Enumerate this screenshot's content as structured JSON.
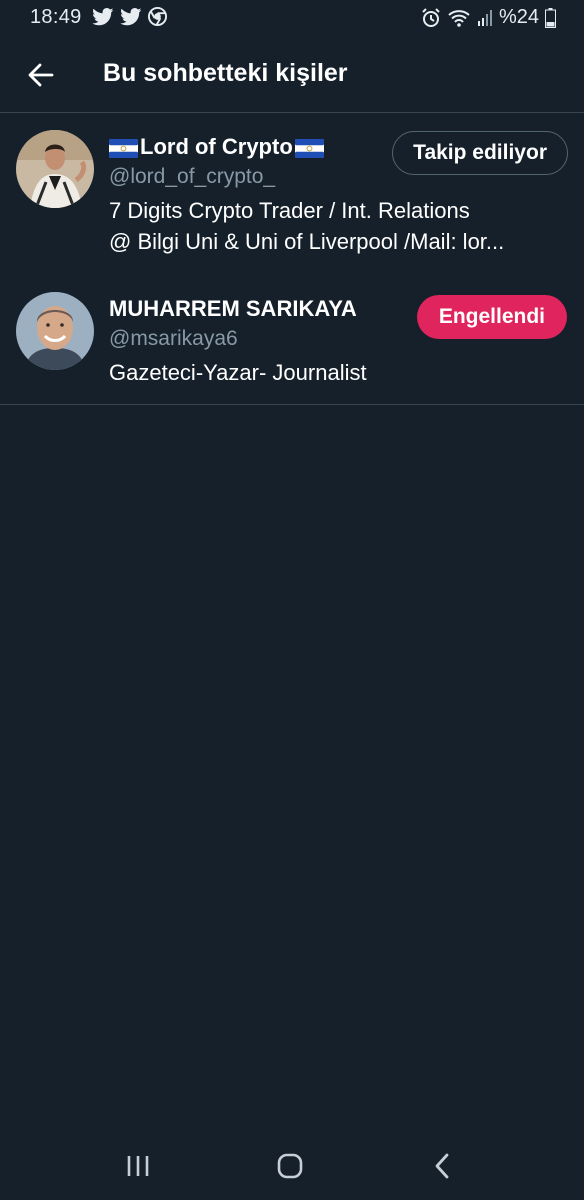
{
  "status_bar": {
    "time": "18:49",
    "left_icons": [
      "twitter-icon",
      "twitter-icon",
      "chrome-icon"
    ],
    "right_icons": [
      "alarm-icon",
      "wifi-icon",
      "signal-icon"
    ],
    "battery_text": "%24"
  },
  "header": {
    "title": "Bu sohbetteki kişiler"
  },
  "users": [
    {
      "name": "Lord of Crypto",
      "name_flags": [
        "el-salvador-flag",
        "el-salvador-flag"
      ],
      "handle": "@lord_of_crypto_",
      "bio_lines": [
        "7 Digits Crypto Trader / Int. Relations",
        "@ Bilgi Uni & Uni of Liverpool /Mail: lor..."
      ],
      "action_label": "Takip ediliyor",
      "action_state": "following"
    },
    {
      "name": "MUHARREM SARIKAYA",
      "handle": "@msarikaya6",
      "bio_lines": [
        "Gazeteci-Yazar- Journalist"
      ],
      "action_label": "Engellendi",
      "action_state": "blocked"
    }
  ],
  "colors": {
    "background": "#15202b",
    "divider": "#38444d",
    "secondary_text": "#8899a6",
    "blocked_button": "#e0245e"
  },
  "nav_bar": {
    "items": [
      "recent-apps-icon",
      "home-icon",
      "back-icon"
    ]
  }
}
